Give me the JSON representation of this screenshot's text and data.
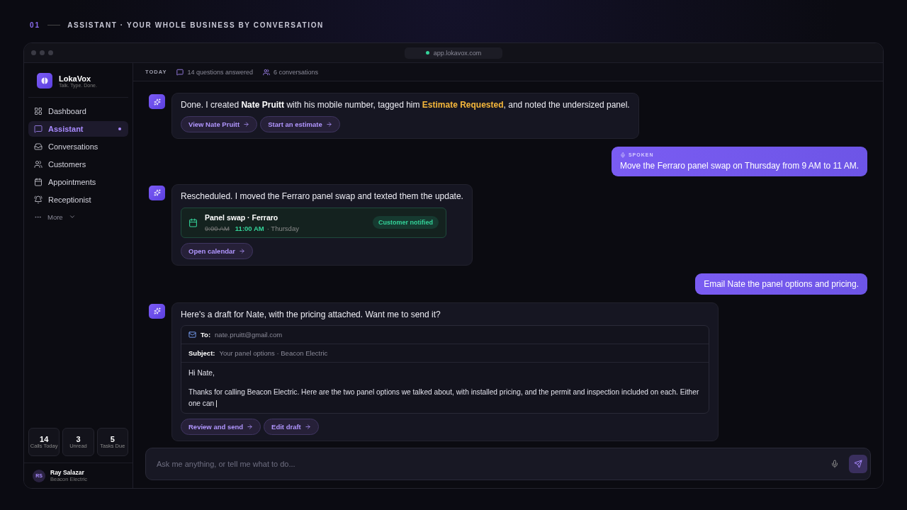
{
  "header": {
    "number": "01",
    "title": "ASSISTANT · YOUR WHOLE BUSINESS BY CONVERSATION"
  },
  "browser": {
    "url": "app.lokavox.com"
  },
  "sidebar": {
    "brand": "LokaVox",
    "tagline": "Talk. Type. Done.",
    "items": [
      {
        "label": "Dashboard",
        "selected": false
      },
      {
        "label": "Assistant",
        "selected": true
      },
      {
        "label": "Conversations",
        "selected": false
      },
      {
        "label": "Customers",
        "selected": false
      },
      {
        "label": "Appointments",
        "selected": false
      },
      {
        "label": "Receptionist",
        "selected": false
      }
    ],
    "more": "More",
    "stats": [
      {
        "value": "14",
        "label": "Calls Today"
      },
      {
        "value": "3",
        "label": "Unread"
      },
      {
        "value": "5",
        "label": "Tasks Due"
      }
    ],
    "user": {
      "initials": "RS",
      "name": "Ray Salazar",
      "company": "Beacon Electric"
    }
  },
  "topbar": {
    "day": "TODAY",
    "questions": "14 questions answered",
    "conversations": "6 conversations"
  },
  "messages": [
    {
      "kind": "assistant",
      "parts": [
        {
          "kind": "plain",
          "text": "Done. I created "
        },
        {
          "kind": "bold",
          "text": "Nate Pruitt"
        },
        {
          "kind": "plain",
          "text": " with his mobile number, tagged him "
        },
        {
          "kind": "tag",
          "text": "Estimate Requested"
        },
        {
          "kind": "plain",
          "text": ", and noted the undersized panel."
        }
      ],
      "actions": [
        "View Nate Pruitt",
        "Start an estimate"
      ]
    },
    {
      "kind": "user",
      "label": "SPOKEN",
      "text": "Move the Ferraro panel swap on Thursday from 9 AM to 11 AM."
    },
    {
      "kind": "assistant",
      "text": "Rescheduled. I moved the Ferraro panel swap and texted them the update.",
      "appointment": {
        "title": "Panel swap · Ferraro",
        "old_time": "9:00 AM",
        "new_time": "11:00 AM",
        "day": "· Thursday",
        "badge": "Customer notified"
      },
      "actions": [
        "Open calendar"
      ]
    },
    {
      "kind": "user",
      "text": "Email Nate the panel options and pricing."
    },
    {
      "kind": "assistant",
      "text": "Here's a draft for Nate, with the pricing attached. Want me to send it?",
      "email": {
        "to_label": "To:",
        "to": "nate.pruitt@gmail.com",
        "subject_label": "Subject:",
        "subject": "Your panel options · Beacon Electric",
        "greeting": "Hi Nate,",
        "body": "Thanks for calling Beacon Electric. Here are the two panel options we talked about, with installed pricing, and the permit and inspection included on each. Either one can"
      },
      "actions": [
        "Review and send",
        "Edit draft"
      ]
    }
  ],
  "composer": {
    "placeholder": "Ask me anything, or tell me what to do..."
  }
}
